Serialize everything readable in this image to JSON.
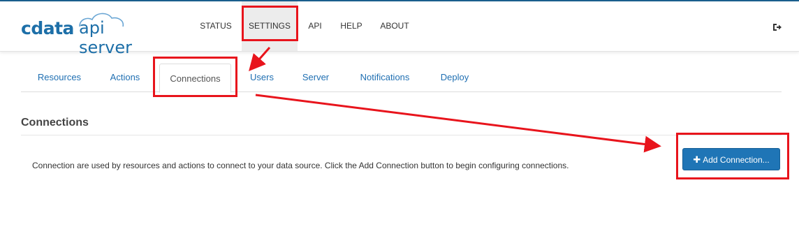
{
  "app": {
    "brand": "cdata",
    "product": "api server"
  },
  "nav": {
    "items": [
      {
        "label": "STATUS"
      },
      {
        "label": "SETTINGS"
      },
      {
        "label": "API"
      },
      {
        "label": "HELP"
      },
      {
        "label": "ABOUT"
      }
    ],
    "active": "SETTINGS"
  },
  "tabs": {
    "items": [
      {
        "label": "Resources"
      },
      {
        "label": "Actions"
      },
      {
        "label": "Connections"
      },
      {
        "label": "Users"
      },
      {
        "label": "Server"
      },
      {
        "label": "Notifications"
      },
      {
        "label": "Deploy"
      }
    ],
    "active": "Connections"
  },
  "connections": {
    "title": "Connections",
    "description": "Connection are used by resources and actions to connect to your data source. Click the Add Connection button to begin configuring connections.",
    "add_button_label": "Add Connection...",
    "add_button_icon": "plus-icon"
  },
  "header": {
    "logout_icon": "logout-icon"
  },
  "colors": {
    "accent": "#1f75b6",
    "brand": "#1d6fa8",
    "annotation": "#e8141c",
    "active_nav_bg": "#ececec"
  }
}
